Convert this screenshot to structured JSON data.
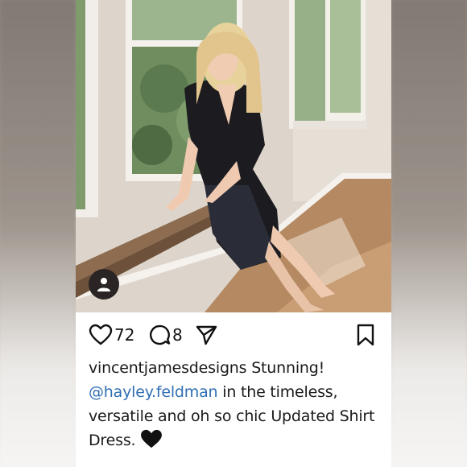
{
  "post": {
    "photo_alt": "Woman in black shirt dress seated on a wooden bench by windows",
    "likes": "72",
    "comments": "8",
    "caption": {
      "username": "vincentjamesdesigns",
      "text_1": "Stunning!",
      "mention": "@hayley.feldman",
      "text_2": "in the timeless, versatile and oh so chic Updated Shirt Dress.",
      "emoji": "black-heart"
    }
  },
  "icons": {
    "avatar": "user-icon",
    "like": "heart-icon",
    "comment": "comment-icon",
    "share": "send-icon",
    "save": "bookmark-icon"
  },
  "colors": {
    "mention": "#2f6fb3",
    "text": "#1a1a1a"
  }
}
